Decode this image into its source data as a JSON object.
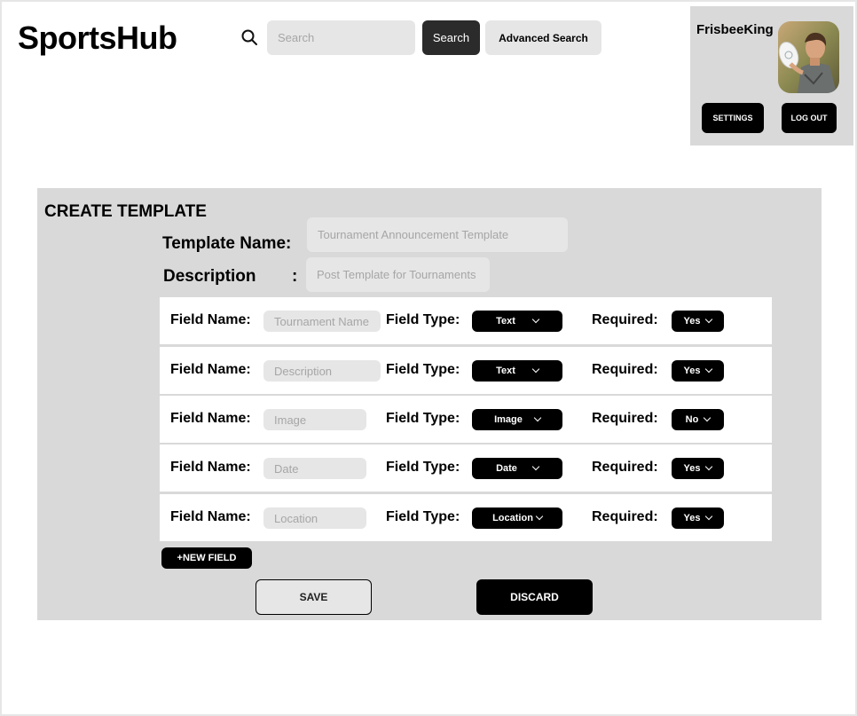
{
  "header": {
    "logo": "SportsHub",
    "search_placeholder": "Search",
    "search_button": "Search",
    "advanced_search_button": "Advanced Search"
  },
  "profile": {
    "username": "FrisbeeKing",
    "settings_button": "SETTINGS",
    "logout_button": "LOG OUT"
  },
  "template": {
    "title": "CREATE TEMPLATE",
    "name_label": "Template Name:",
    "name_placeholder": "Tournament Announcement Template",
    "description_label": "Description",
    "description_colon": ":",
    "description_placeholder": "Post Template for Tournaments",
    "field_name_label": "Field Name:",
    "field_type_label": "Field Type:",
    "required_label": "Required:",
    "fields": [
      {
        "name_placeholder": "Tournament Name",
        "type": "Text",
        "required": "Yes"
      },
      {
        "name_placeholder": "Description",
        "type": "Text",
        "required": "Yes"
      },
      {
        "name_placeholder": "Image",
        "type": "Image",
        "required": "No"
      },
      {
        "name_placeholder": "Date",
        "type": "Date",
        "required": "Yes"
      },
      {
        "name_placeholder": "Location",
        "type": "Location",
        "required": "Yes"
      }
    ],
    "new_field_button": "+NEW FIELD",
    "save_button": "SAVE",
    "discard_button": "DISCARD"
  }
}
